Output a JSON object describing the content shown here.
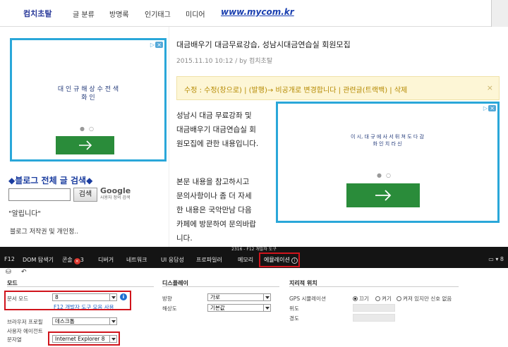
{
  "blog": {
    "nav": {
      "brand": "컴치초탈",
      "items": [
        "글 분류",
        "방명록",
        "인기태그",
        "미디어"
      ],
      "site_url": "www.mycom.kr"
    },
    "ad_left": {
      "text_line1": "대 인 규 해 상 수 전 색",
      "text_line2": "화 인"
    },
    "ad_right": {
      "text_line1": "이 시, 대 규 에 사 서 뒤 쳐 도 다 감",
      "text_line2": "화 인 치 라 신"
    },
    "search": {
      "title": "◆블로그 전체 글 검색◆",
      "input_value": "",
      "button_label": "검색",
      "google_label": "Google",
      "google_sub": "사용자 정의 검색"
    },
    "notice": "\"알립니다\"",
    "copyright": "블로그 저작권 및 개인정..",
    "post": {
      "title": "대금배우기 대금무료강습, 성남시대금연습실 회원모집",
      "meta": "2015.11.10 10:12 / by 컴치초탈",
      "edit_bar": "수정 : 수정(창으로) | (발행)→ 비공개로 변경합니다 | 관련글(트랙백) | 삭제",
      "edit_close": "×",
      "para1": [
        "성남시 대금 무료강좌 및",
        "대금배우기 대금연습실 회",
        "원모집에 관한 내용입니다."
      ],
      "para2": [
        "본문 내용을 참고하시고",
        "문의사항이나 좀 더 자세",
        "한 내용은 국악만남 다음",
        "카페에 방문하여 문의바랍",
        "니다."
      ]
    }
  },
  "devtools": {
    "window_title": "2316 - F12 개발자 도구",
    "tabs": [
      {
        "label": "F12"
      },
      {
        "label": "DOM 탐색기"
      },
      {
        "label": "콘솔",
        "badge": "3"
      },
      {
        "label": "디버거"
      },
      {
        "label": "네트워크"
      },
      {
        "label": "UI 응답성"
      },
      {
        "label": "프로파일러"
      },
      {
        "label": "메모리"
      },
      {
        "label": "에뮬레이션"
      }
    ],
    "right_count": "8",
    "mode": {
      "header": "모드",
      "doc_mode_label": "문서 모드",
      "doc_mode_value": "8",
      "doc_mode_note": "F12 개발자 도구 모음 사용",
      "browser_profile_label": "브라우저 프로필",
      "browser_profile_value": "데스크톱",
      "user_agent_label": "사용자 에이전트",
      "user_agent_label2": "문자열",
      "user_agent_value": "Internet Explorer 8"
    },
    "display": {
      "header": "디스플레이",
      "orientation_label": "방향",
      "orientation_value": "가로",
      "resolution_label": "해상도",
      "resolution_value": "기본값"
    },
    "geo": {
      "header": "지리적 위치",
      "gps_label": "GPS 시뮬레이션",
      "radio_off": "끄기",
      "radio_on": "켜기",
      "radio_nosignal": "켜져 있지만 신호 없음",
      "lat_label": "위도",
      "lon_label": "경도"
    }
  }
}
